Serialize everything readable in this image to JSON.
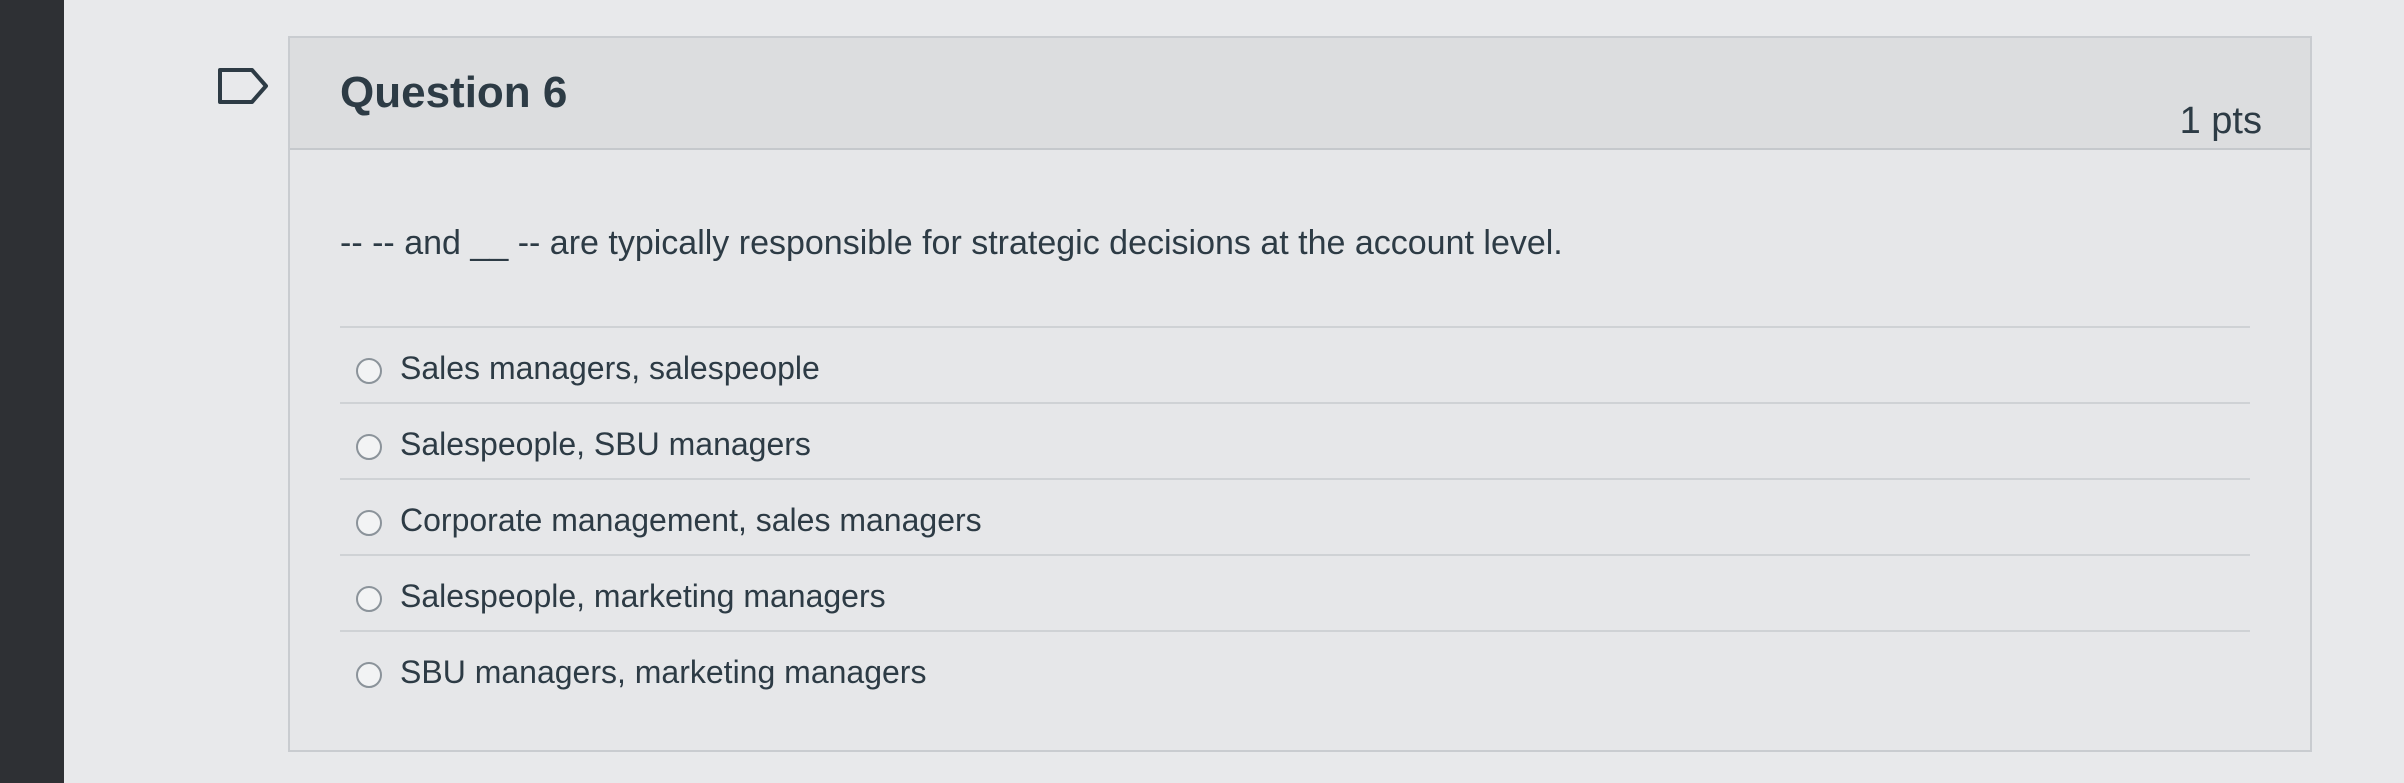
{
  "question": {
    "title": "Question 6",
    "points": "1 pts",
    "text_parts": {
      "blank_1a": "--",
      "blank_1b": "--",
      "connector": "and",
      "blank_2a": "__",
      "blank_2b": "--",
      "rest": "are typically responsible for strategic decisions at the account level."
    }
  },
  "answers": [
    {
      "label": "Sales managers, salespeople",
      "selected": false
    },
    {
      "label": "Salespeople, SBU managers",
      "selected": false
    },
    {
      "label": "Corporate management, sales managers",
      "selected": false
    },
    {
      "label": "Salespeople, marketing managers",
      "selected": false
    },
    {
      "label": "SBU managers, marketing managers",
      "selected": false
    }
  ],
  "icons": {
    "flag": "flag-icon"
  },
  "colors": {
    "text": "#2d3b45",
    "header_bg": "#dcdddf",
    "border": "#c9ccd0"
  }
}
